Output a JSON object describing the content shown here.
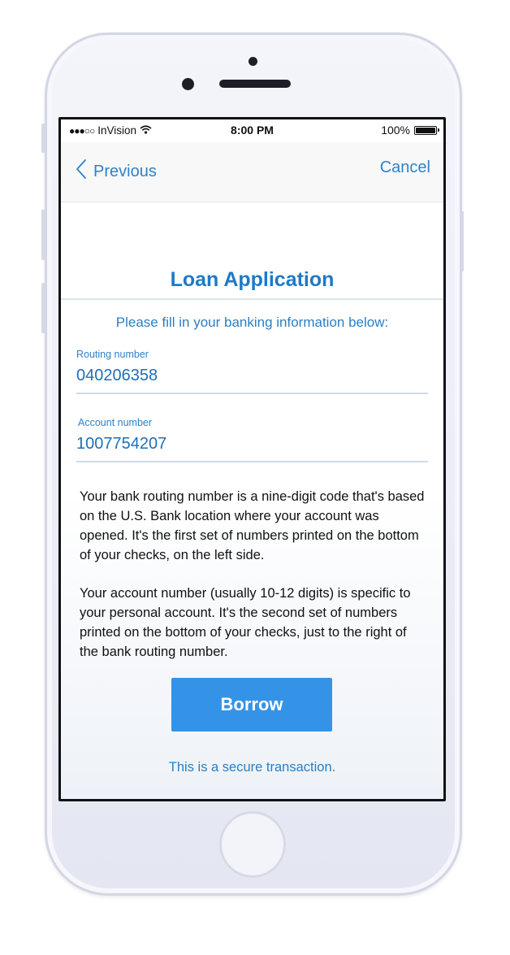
{
  "status_bar": {
    "carrier": "InVision",
    "signal_dots": "●●●○○",
    "time": "8:00 PM",
    "battery": "100%",
    "icons": [
      "wifi-icon",
      "battery-icon"
    ]
  },
  "nav": {
    "back_label": "Previous",
    "back_icon": "chevron-left-icon",
    "cancel_label": "Cancel"
  },
  "form": {
    "title": "Loan Application",
    "subtitle": "Please fill in your banking information below:",
    "routing": {
      "label": "Routing number",
      "value": "040206358"
    },
    "account": {
      "label": "Account number",
      "value": "1007754207"
    }
  },
  "info": {
    "routing_text": "Your bank routing number is a nine-digit code that's based on the U.S. Bank location where your account was opened. It's the first set of numbers printed on the bottom of your checks, on the left side.",
    "account_text": "Your account number (usually 10-12 digits) is specific to your personal account. It's the second set of numbers printed on the bottom of your checks, just to the right of the bank routing number."
  },
  "actions": {
    "borrow_label": "Borrow",
    "secure_note": "This is a secure transaction."
  },
  "colors": {
    "accent": "#2f82c9",
    "button": "#3493e6",
    "title": "#1f79c6"
  }
}
